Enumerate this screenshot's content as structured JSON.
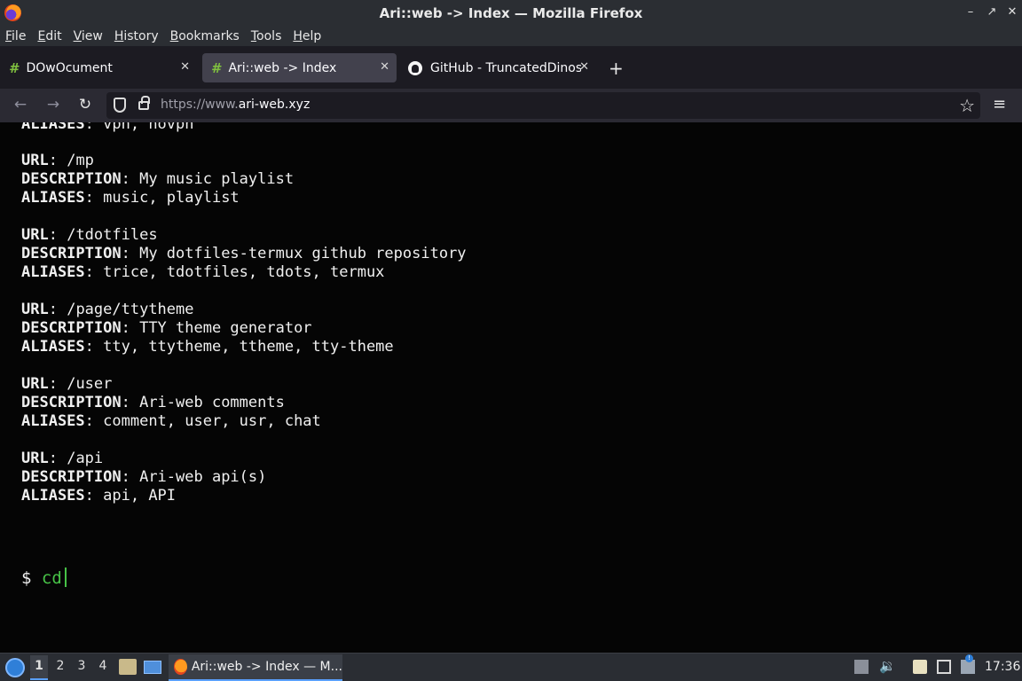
{
  "window": {
    "title": "Ari::web -> Index — Mozilla Firefox",
    "controls": {
      "minimize": "–",
      "maximize": "↗",
      "close": "✕"
    }
  },
  "menubar": [
    "File",
    "Edit",
    "View",
    "History",
    "Bookmarks",
    "Tools",
    "Help"
  ],
  "tabs": [
    {
      "label": "DOwOcument",
      "icon": "hash-favicon",
      "active": false
    },
    {
      "label": "Ari::web -> Index",
      "icon": "hash-favicon",
      "active": true
    },
    {
      "label": "GitHub - TruncatedDinos",
      "icon": "github-icon",
      "active": false
    }
  ],
  "favicon_text": "#",
  "new_tab_label": "+",
  "nav": {
    "back": "←",
    "forward": "→",
    "reload": "↻",
    "url_protocol": "https://www.",
    "url_domain": "ari-web.xyz",
    "bookmark_star": "☆",
    "menu": "≡"
  },
  "content": {
    "partial_line": {
      "key": "ALIASES",
      "sep": ":",
      "value": " vpn, novpn"
    },
    "entries": [
      {
        "url": "/mp",
        "description": "My music playlist",
        "aliases": "music, playlist"
      },
      {
        "url": "/tdotfiles",
        "description": "My dotfiles-termux github repository",
        "aliases": "trice, tdotfiles, tdots, termux"
      },
      {
        "url": "/page/ttytheme",
        "description": "TTY theme generator",
        "aliases": "tty, ttytheme, ttheme, tty-theme"
      },
      {
        "url": "/user",
        "description": "Ari-web comments",
        "aliases": "comment, user, usr, chat"
      },
      {
        "url": "/api",
        "description": "Ari-web api(s)",
        "aliases": "api, API"
      }
    ],
    "labels": {
      "url": "URL",
      "description": "DESCRIPTION",
      "aliases": "ALIASES"
    },
    "prompt_symbol": "$",
    "prompt_command": "cd"
  },
  "taskbar": {
    "desktops": [
      "1",
      "2",
      "3",
      "4"
    ],
    "current_desktop": "1",
    "task_label": "Ari::web -> Index — M...",
    "clock": "17:36",
    "volume_icon": "🔉",
    "badge": "!"
  }
}
